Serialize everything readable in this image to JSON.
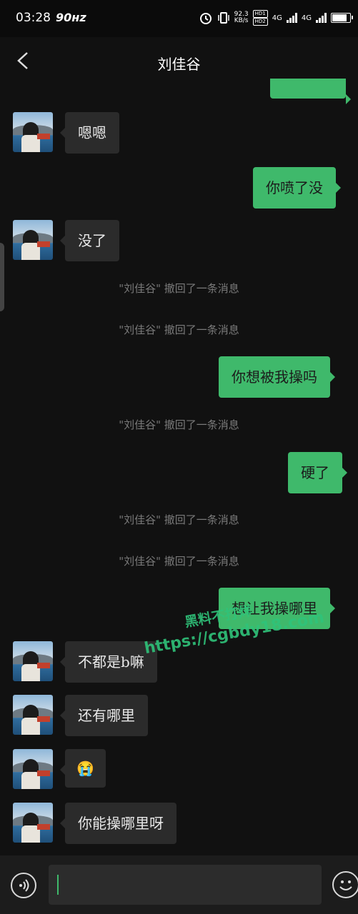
{
  "status": {
    "time": "03:28",
    "hz": "90ʜz",
    "speed": "92.3",
    "speed_unit": "KB/s",
    "hd1": "HD1",
    "hd2": "HD2",
    "network": "4G"
  },
  "header": {
    "title": "刘佳谷"
  },
  "messages": {
    "m1": "嗯嗯",
    "m2": "你喷了没",
    "m3": "没了",
    "m4": "你想被我操吗",
    "m5": "硬了",
    "m6": "想让我操哪里",
    "m7": "不都是b嘛",
    "m8": "还有哪里",
    "m9": "😭",
    "m10": "你能操哪里呀"
  },
  "system": {
    "recall": "\"刘佳谷\" 撤回了一条消息"
  },
  "watermark": {
    "line1": "黑料不打烊",
    "line2": "https://cgbdy18.com"
  },
  "icons": [
    "back-icon",
    "voice-icon",
    "emoji-icon",
    "avatar"
  ]
}
